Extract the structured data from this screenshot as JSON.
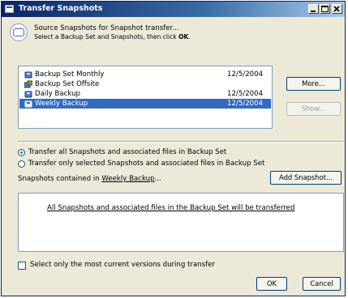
{
  "window": {
    "title": "Transfer Snapshots"
  },
  "header": {
    "title": "Source Snapshots for Snapshot transfer...",
    "instruction_prefix": "Select a Backup Set and Snapshots, then click ",
    "instruction_bold": "OK",
    "instruction_suffix": "."
  },
  "backup_sets": [
    {
      "name": "Backup Set Monthly",
      "date": "12/5/2004",
      "icon": "backup-set-icon",
      "selected": false
    },
    {
      "name": "Backup Set Offsite",
      "date": "",
      "icon": "offsite-backup-set-icon",
      "selected": false
    },
    {
      "name": "Daily Backup",
      "date": "12/5/2004",
      "icon": "backup-set-icon",
      "selected": false
    },
    {
      "name": "Weekly Backup",
      "date": "12/5/2004",
      "icon": "backup-set-icon",
      "selected": true
    }
  ],
  "buttons": {
    "more": "More...",
    "show": "Show...",
    "add_snapshot": "Add Snapshot...",
    "ok": "OK",
    "cancel": "Cancel"
  },
  "options": {
    "transfer_all": "Transfer all Snapshots and associated files in Backup Set",
    "transfer_selected": "Transfer only selected Snapshots and associated files in Backup Set",
    "selected_option": "transfer_all"
  },
  "snapshots": {
    "label_prefix": "Snapshots contained in ",
    "label_set": "Weekly Backup",
    "label_suffix": "...",
    "message": "All Snapshots and associated files in the Backup Set will be transferred"
  },
  "current_versions": {
    "label": "Select only the most current versions during transfer",
    "checked": false
  },
  "colors": {
    "title_bar": "#0a246a",
    "selection": "#316ac5",
    "dialog_face": "#ece9d8"
  }
}
